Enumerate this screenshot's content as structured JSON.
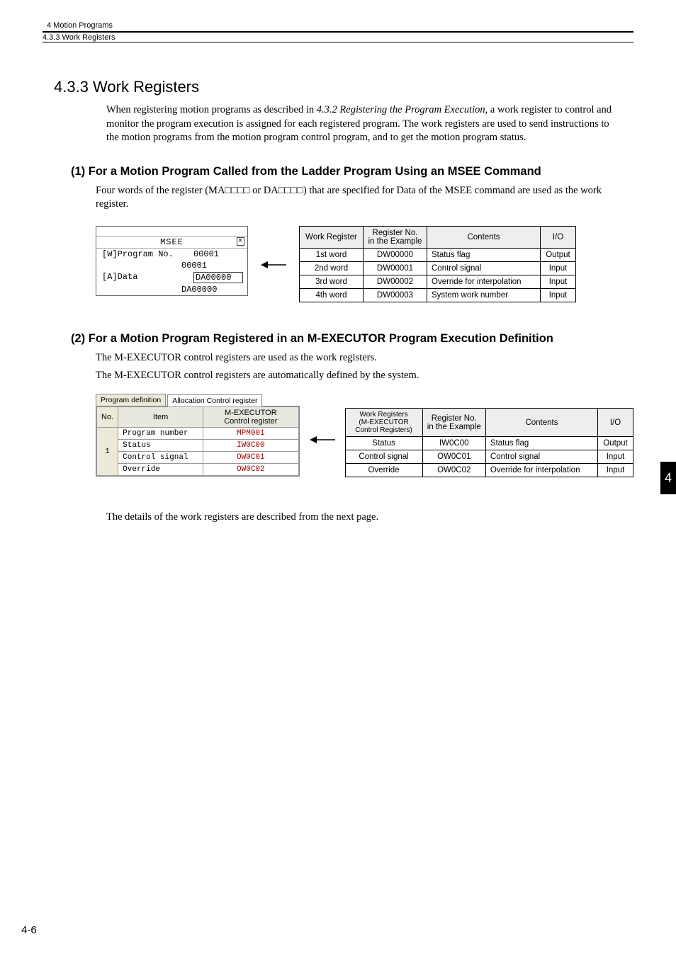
{
  "header": {
    "chapter": "4  Motion Programs",
    "breadcrumb": "4.3.3  Work Registers"
  },
  "section": {
    "number_title": "4.3.3  Work Registers",
    "intro": "When registering motion programs as described in ",
    "intro_ref": "4.3.2 Registering the Program Execution",
    "intro_tail": ", a work register to control and monitor the program execution is assigned for each registered program. The work registers are used to send instructions to the motion programs from the motion program control program, and to get the motion program status."
  },
  "sub1": {
    "heading": "(1) For a Motion Program Called from the Ladder Program Using an MSEE Command",
    "para_a": "Four words of the register (MA",
    "para_b": " or DA",
    "para_c": ") that are specified for Data of the MSEE command are used as the work register.",
    "boxes": "□□□□",
    "msee": {
      "title": "MSEE",
      "row1_label": "[W]Program No.",
      "row1_val": "00001",
      "row2_val": "00001",
      "row3_label": "[A]Data",
      "row3_val": "DA00000",
      "row4_val": "DA00000"
    },
    "table": {
      "h1": "Work Register",
      "h2_a": "Register No.",
      "h2_b": "in the Example",
      "h3": "Contents",
      "h4": "I/O",
      "rows": [
        {
          "wr": "1st word",
          "rn": "DW00000",
          "ct": "Status flag",
          "io": "Output"
        },
        {
          "wr": "2nd word",
          "rn": "DW00001",
          "ct": "Control signal",
          "io": "Input"
        },
        {
          "wr": "3rd word",
          "rn": "DW00002",
          "ct": "Override for interpolation",
          "io": "Input"
        },
        {
          "wr": "4th word",
          "rn": "DW00003",
          "ct": "System work number",
          "io": "Input"
        }
      ]
    }
  },
  "sub2": {
    "heading": "(2) For a Motion Program Registered in an M-EXECUTOR Program Execution Definition",
    "p1": "The M-EXECUTOR control registers are used as the work registers.",
    "p2": "The M-EXECUTOR control registers are automatically defined by the system.",
    "panel": {
      "tab_inactive": "Program definition",
      "tab_active": "Allocation Control register",
      "col_no": "No.",
      "col_item": "Item",
      "col_reg_a": "M-EXECUTOR",
      "col_reg_b": "Control register",
      "no_val": "1",
      "rows": [
        {
          "item": "Program number",
          "val": "MPM001"
        },
        {
          "item": "Status",
          "val": "IW0C00"
        },
        {
          "item": "Control signal",
          "val": "OW0C01"
        },
        {
          "item": "Override",
          "val": "OW0C02"
        }
      ]
    },
    "table": {
      "h1_a": "Work Registers",
      "h1_b": "(M-EXECUTOR",
      "h1_c": "Control Registers)",
      "h2_a": "Register No.",
      "h2_b": "in the Example",
      "h3": "Contents",
      "h4": "I/O",
      "rows": [
        {
          "wr": "Status",
          "rn": "IW0C00",
          "ct": "Status flag",
          "io": "Output"
        },
        {
          "wr": "Control signal",
          "rn": "OW0C01",
          "ct": "Control signal",
          "io": "Input"
        },
        {
          "wr": "Override",
          "rn": "OW0C02",
          "ct": "Override for interpolation",
          "io": "Input"
        }
      ]
    }
  },
  "footer_para": "The details of the work registers are described from the next page.",
  "page_number": "4-6",
  "side_tab": "4"
}
